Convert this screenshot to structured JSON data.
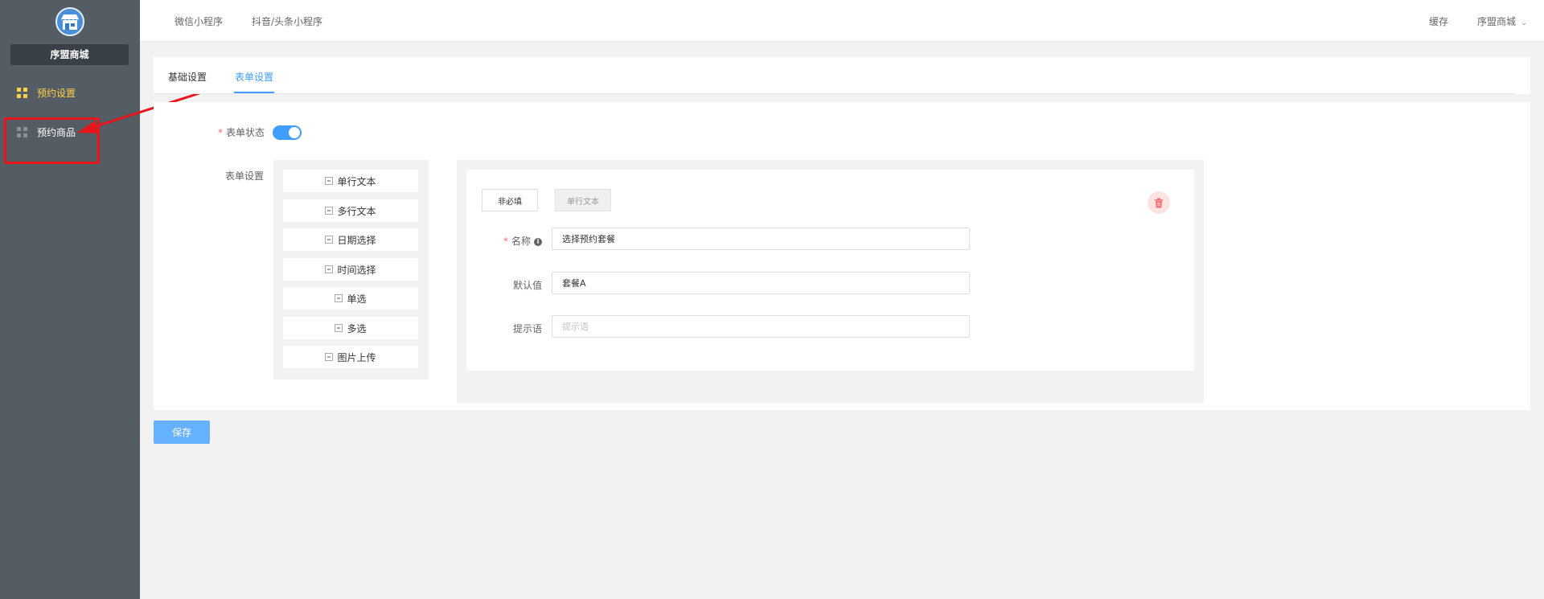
{
  "sidebar": {
    "shop_name": "序盟商城",
    "items": [
      {
        "label": "预约设置",
        "active": true
      },
      {
        "label": "预约商品",
        "active": false
      }
    ]
  },
  "topbar": {
    "links": [
      "微信小程序",
      "抖音/头条小程序"
    ],
    "cache_label": "缓存",
    "user_label": "序盟商城"
  },
  "tabs": [
    "基础设置",
    "表单设置"
  ],
  "form": {
    "status_label": "表单状态",
    "status_on": true,
    "settings_label": "表单设置",
    "palette": [
      "单行文本",
      "多行文本",
      "日期选择",
      "时间选择",
      "单选",
      "多选",
      "图片上传"
    ],
    "field": {
      "required_button": "非必填",
      "type_button": "单行文本",
      "name_label": "名称",
      "name_value": "选择预约套餐",
      "default_label": "默认值",
      "default_value": "套餐A",
      "hint_label": "提示语",
      "hint_placeholder": "提示语"
    }
  },
  "save_label": "保存",
  "colors": {
    "sidebar_bg": "#545c64",
    "accent": "#409eff",
    "active_menu": "#ffd04b",
    "annotation_red": "#e8151b"
  }
}
